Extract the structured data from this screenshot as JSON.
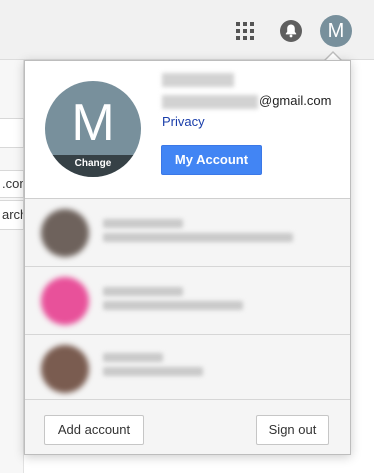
{
  "topbar": {
    "apps_icon": "apps-grid-icon",
    "notifications_icon": "bell-icon",
    "avatar_letter": "M",
    "avatar_color": "#78909c"
  },
  "background_page": {
    "fragment_1": ".com",
    "fragment_2": "arch"
  },
  "profile": {
    "avatar_letter": "M",
    "change_label": "Change",
    "email_domain": "@gmail.com",
    "privacy_label": "Privacy",
    "my_account_label": "My Account",
    "accent_color": "#4285f4",
    "link_color": "#1a3eaa"
  },
  "accounts": [
    {
      "avatar_color": "#6e625c"
    },
    {
      "avatar_color": "#e8519a"
    },
    {
      "avatar_color": "#7a5c50"
    }
  ],
  "footer": {
    "add_account_label": "Add account",
    "sign_out_label": "Sign out"
  }
}
